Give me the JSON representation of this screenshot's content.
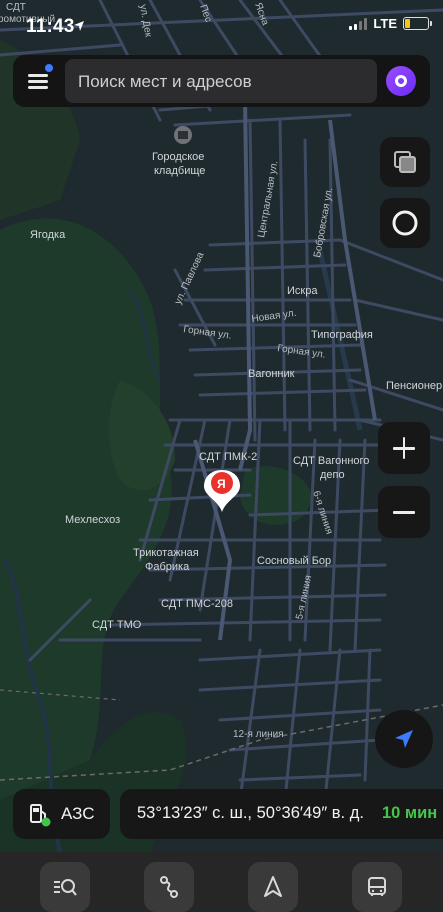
{
  "status": {
    "time": "11:43",
    "network": "LTE"
  },
  "search": {
    "placeholder": "Поиск мест и адресов"
  },
  "map": {
    "labels": {
      "cemetery_1": "Городское",
      "cemetery_2": "кладбище",
      "yagodka": "Ягодка",
      "tsentralnaya": "Центральная ул.",
      "bobrovskaya": "Бобровская ул.",
      "pavlova": "ул. Павлова",
      "iskra": "Искра",
      "novaya": "Новая ул.",
      "tipografiya": "Типография",
      "gornaya1": "Горная ул.",
      "gornaya2": "Горная ул.",
      "vagonnik": "Вагонник",
      "pensioner": "Пенсионер",
      "sdt_pmk2": "СДТ ПМК-2",
      "sdt_vagon_1": "СДТ Вагонного",
      "sdt_vagon_2": "депо",
      "line6": "6-я линия",
      "mehleshoz": "Мехлесхоз",
      "trikotazh_1": "Трикотажная",
      "trikotazh_2": "Фабрика",
      "sosnovy": "Сосновый Бор",
      "line5": "5-я линия",
      "sdt_pms208": "СДТ ПМС-208",
      "sdt_tmo": "СДТ ТМО",
      "line12": "12-я линия",
      "top_sdt": "СДТ",
      "top_sdt2": "ромотивный",
      "top_pes": "Пес",
      "top_deg": "ул. Дек",
      "top_yasn": "Ясна",
      "marker": "Я"
    }
  },
  "gas_button": {
    "label": "АЗС"
  },
  "coords": {
    "text": "53°13′23″ с. ш., 50°36′49″ в. д.",
    "eta": "10 мин"
  },
  "bottom_tabs": [
    "search-list",
    "route",
    "navigator",
    "transport"
  ]
}
